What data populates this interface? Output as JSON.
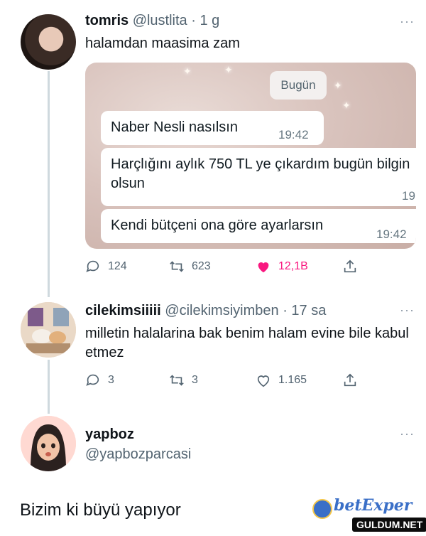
{
  "tweet1": {
    "name": "tomris",
    "handle": "@lustlita",
    "time": "· 1 g",
    "text": "halamdan maasima zam",
    "media": {
      "date_chip": "Bugün",
      "messages": [
        {
          "text": "Naber Nesli nasılsın",
          "time": "19:42"
        },
        {
          "text": "Harçlığını aylık 750 TL ye çıkardım bugün bilgin olsun",
          "time": "19"
        },
        {
          "text": "Kendi bütçeni ona göre ayarlarsın",
          "time": "19:42"
        }
      ]
    },
    "actions": {
      "replies": "124",
      "retweets": "623",
      "likes": "12,1B"
    }
  },
  "tweet2": {
    "name": "cilekimsiiiii",
    "handle": "@cilekimsiyimben",
    "time": "· 17 sa",
    "text": "milletin halalarina bak benim halam evine bile kabul etmez",
    "actions": {
      "replies": "3",
      "retweets": "3",
      "likes": "1.165"
    }
  },
  "tweet3": {
    "name": "yapboz",
    "handle": "@yapbozparcasi"
  },
  "caption": "Bizim ki büyü yapıyor",
  "watermark": {
    "top": "betExper",
    "bottom": "GULDUM.NET"
  },
  "more_glyph": "···",
  "colors": {
    "like": "#f91880",
    "muted": "#536471",
    "thread_line": "#cfd9de"
  }
}
